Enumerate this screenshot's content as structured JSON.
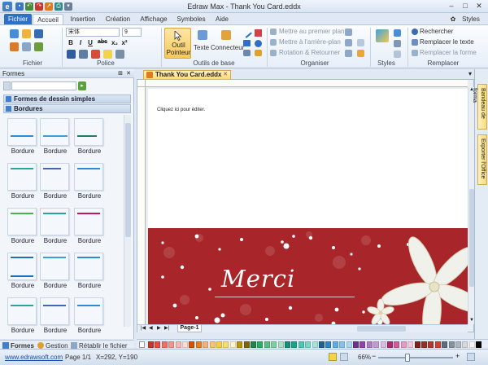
{
  "window": {
    "title": "Edraw Max - Thank You Card.eddx",
    "styles_label": "Styles",
    "minimize": "–",
    "maximize": "□",
    "close": "✕",
    "quick_access": [
      "save-icon",
      "undo-icon",
      "redo-icon",
      "export-icon",
      "print-icon"
    ]
  },
  "ribbon_tabs": [
    "Fichier",
    "Accueil",
    "Insertion",
    "Création",
    "Affichage",
    "Symboles",
    "Aide"
  ],
  "ribbon": {
    "groups": {
      "file": "Fichier",
      "font": "Police",
      "basic_tools": "Outils de base",
      "arrange": "Organiser",
      "styles": "Styles",
      "replace": "Remplacer"
    },
    "font_name": "宋体",
    "font_size": "9",
    "format_buttons": [
      "B",
      "I",
      "U",
      "abc",
      "x₂",
      "x²"
    ],
    "tools": {
      "pointer": "Outil Pointeur",
      "text": "Texte",
      "connector": "Connecteur"
    },
    "arrange_items": [
      "Mettre au premier plan",
      "Mettre à l'arrière-plan",
      "Rotation & Retourner"
    ],
    "replace_items": [
      "Rechercher",
      "Remplacer le texte",
      "Remplacer la forme"
    ]
  },
  "left_panel": {
    "title": "Formes",
    "categories": [
      "Formes de dessin simples",
      "Bordures"
    ],
    "shape_label": "Bordure",
    "shape_count": 15,
    "bottom_tabs": [
      "Formes",
      "Gestion",
      "Rétablir le fichier"
    ]
  },
  "document": {
    "tab_title": "Thank You Card.eddx",
    "placeholder_text": "Cliquez ici pour éditer.",
    "card_text": "Merci",
    "page_tab": "Page-1"
  },
  "side_tabs": [
    "Bandeau de forma",
    "Exporter l'Office"
  ],
  "colors": {
    "accent": "#2f6fc6",
    "card_background": "#a8262a",
    "palette": [
      "#c0392b",
      "#e74c3c",
      "#ec7063",
      "#f1948a",
      "#f5b7b1",
      "#fadbd8",
      "#d35400",
      "#e67e22",
      "#f0b27a",
      "#f8c471",
      "#f4d03f",
      "#f7dc6f",
      "#fcf3cf",
      "#b7950b",
      "#7d6608",
      "#1e8449",
      "#27ae60",
      "#52be80",
      "#7dcea0",
      "#a9dfbf",
      "#148f77",
      "#17a589",
      "#48c9b0",
      "#76d7c4",
      "#a3e4d7",
      "#1f618d",
      "#2e86c1",
      "#5dade2",
      "#85c1e9",
      "#aed6f1",
      "#6c3483",
      "#8e44ad",
      "#af7ac5",
      "#c39bd3",
      "#d7bde2",
      "#ab2b6d",
      "#d35c9a",
      "#e59ac0",
      "#f4c6dc",
      "#7b241c",
      "#943126",
      "#b03a2e",
      "#cb4335",
      "#5d6d7e",
      "#85929e",
      "#aeb6bf",
      "#d5d8dc",
      "#f2f3f4",
      "#000000"
    ]
  },
  "status": {
    "link": "www.edrawsoft.com",
    "page": "Page 1/1",
    "coords": "X=292, Y=190",
    "zoom": "66%"
  }
}
